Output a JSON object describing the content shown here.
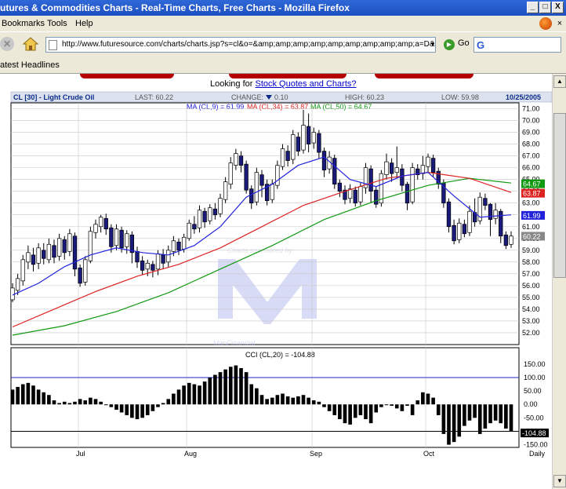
{
  "window": {
    "title": "utures & Commodities Charts - Real-Time Charts, Free Charts - Mozilla Firefox",
    "minimize": "_",
    "maximize": "□",
    "close": "X"
  },
  "menu": {
    "items": [
      "Bookmarks",
      "Tools",
      "Help"
    ],
    "close": "×"
  },
  "nav": {
    "url": "http://www.futuresource.com/charts/charts.jsp?s=cl&o=&amp;amp;amp;amp;amp;amp;amp;amp;amp;a=D&",
    "go_label": "Go",
    "search_placeholder": "",
    "stop": "✕"
  },
  "bookmarks": {
    "items": [
      "atest Headlines"
    ]
  },
  "page": {
    "looking_for_prefix": "Looking for ",
    "looking_for_link": "Stock Quotes and Charts?"
  },
  "header": {
    "symbol": "CL [30] - Light Crude Oil",
    "last": "LAST: 60.22",
    "change_label": "CHANGE:",
    "change_value": "0.10",
    "high": "HIGH: 60.23",
    "low": "LOW: 59.98",
    "date": "10/25/2005"
  },
  "legend": {
    "ma9": "MA (CL,9) = 61.99",
    "ma34": "MA (CL,34) = 63.87",
    "ma50": "MA (CL,50) = 64.67",
    "cci": "CCI (CL,20) = -104.88"
  },
  "watermark": {
    "sponsor": "Charts sponsored by:",
    "brand": "ManFinancial"
  },
  "colors": {
    "bull": "#ffffff",
    "bear": "#1a1a7a",
    "ma9": "#2222dd",
    "ma34": "#dd2222",
    "ma50": "#119911",
    "grid": "#c8c8c8",
    "header_bg": "#dde3ee",
    "accent": "#0a2a8a"
  },
  "chart_data": [
    {
      "type": "candlestick",
      "title": "CL [30] - Light Crude Oil",
      "x": [
        "Jul",
        "Aug",
        "Sep",
        "Oct",
        "Daily"
      ],
      "ylim": [
        51,
        71.5
      ],
      "yticks": [
        "71.00",
        "70.00",
        "69.00",
        "68.00",
        "67.00",
        "66.00",
        "65.00",
        "64.00",
        "63.00",
        "62.00",
        "61.00",
        "60.00",
        "59.00",
        "58.00",
        "57.00",
        "56.00",
        "55.00",
        "54.00",
        "53.00",
        "52.00"
      ],
      "tags": [
        {
          "value": 64.67,
          "label": "64.67",
          "color": "#119911"
        },
        {
          "value": 63.87,
          "label": "63.87",
          "color": "#dd2222"
        },
        {
          "value": 61.99,
          "label": "61.99",
          "color": "#2222dd"
        },
        {
          "value": 60.22,
          "label": "60.22",
          "color": "#888888"
        }
      ],
      "candles": [
        [
          54.8,
          55.8,
          54.6,
          56.2
        ],
        [
          55.6,
          56.6,
          55.2,
          57.0
        ],
        [
          56.4,
          58.2,
          56.0,
          58.6
        ],
        [
          58.0,
          58.8,
          57.4,
          59.4
        ],
        [
          58.6,
          57.8,
          57.2,
          59.2
        ],
        [
          57.9,
          59.2,
          57.4,
          59.6
        ],
        [
          59.0,
          58.3,
          57.8,
          59.6
        ],
        [
          58.2,
          59.5,
          57.9,
          60.0
        ],
        [
          59.4,
          58.4,
          57.9,
          59.9
        ],
        [
          58.5,
          60.0,
          58.1,
          60.4
        ],
        [
          59.9,
          58.8,
          58.2,
          60.2
        ],
        [
          58.9,
          60.4,
          58.5,
          60.8
        ],
        [
          60.2,
          57.4,
          56.8,
          60.5
        ],
        [
          57.5,
          56.2,
          55.9,
          57.8
        ],
        [
          56.3,
          58.2,
          56.0,
          58.5
        ],
        [
          58.1,
          60.6,
          57.9,
          61.0
        ],
        [
          60.5,
          61.2,
          60.0,
          61.6
        ],
        [
          61.0,
          61.8,
          60.5,
          62.0
        ],
        [
          61.7,
          60.8,
          60.3,
          62.1
        ],
        [
          60.9,
          59.3,
          58.8,
          61.2
        ],
        [
          59.4,
          60.8,
          59.0,
          61.2
        ],
        [
          60.7,
          59.2,
          58.8,
          61.0
        ],
        [
          59.3,
          60.4,
          58.7,
          60.7
        ],
        [
          60.3,
          58.8,
          57.9,
          60.6
        ],
        [
          58.9,
          58.0,
          57.5,
          59.3
        ],
        [
          58.1,
          57.3,
          56.9,
          58.5
        ],
        [
          57.4,
          57.9,
          56.8,
          58.2
        ],
        [
          57.8,
          57.3,
          56.7,
          58.1
        ],
        [
          57.4,
          58.7,
          56.9,
          59.0
        ],
        [
          58.6,
          57.9,
          57.4,
          59.1
        ],
        [
          58.0,
          59.0,
          57.6,
          59.4
        ],
        [
          58.9,
          59.8,
          58.5,
          60.2
        ],
        [
          59.7,
          59.0,
          58.6,
          60.0
        ],
        [
          59.1,
          60.1,
          58.8,
          60.4
        ],
        [
          60.0,
          61.3,
          59.8,
          61.6
        ],
        [
          61.2,
          60.8,
          60.4,
          61.9
        ],
        [
          60.9,
          62.4,
          60.5,
          62.8
        ],
        [
          62.3,
          61.4,
          60.9,
          62.6
        ],
        [
          61.5,
          62.6,
          61.2,
          62.9
        ],
        [
          62.5,
          62.0,
          61.6,
          63.0
        ],
        [
          62.1,
          63.4,
          61.8,
          63.8
        ],
        [
          63.3,
          64.8,
          63.0,
          65.2
        ],
        [
          64.6,
          66.4,
          64.2,
          66.9
        ],
        [
          66.2,
          67.2,
          65.8,
          67.6
        ],
        [
          67.0,
          66.2,
          65.6,
          67.4
        ],
        [
          66.3,
          64.1,
          63.8,
          66.6
        ],
        [
          64.2,
          63.0,
          62.5,
          64.5
        ],
        [
          63.1,
          65.6,
          62.8,
          66.0
        ],
        [
          65.4,
          64.5,
          63.5,
          65.8
        ],
        [
          64.6,
          63.2,
          62.8,
          65.0
        ],
        [
          63.3,
          64.6,
          63.0,
          65.0
        ],
        [
          64.5,
          66.2,
          64.2,
          66.6
        ],
        [
          66.1,
          67.6,
          65.8,
          68.0
        ],
        [
          67.4,
          66.6,
          66.1,
          67.9
        ],
        [
          66.7,
          68.8,
          66.3,
          69.2
        ],
        [
          68.6,
          67.4,
          67.0,
          69.0
        ],
        [
          67.5,
          69.6,
          67.2,
          70.9
        ],
        [
          69.5,
          68.0,
          67.3,
          70.6
        ],
        [
          68.1,
          69.0,
          67.6,
          69.4
        ],
        [
          68.9,
          67.3,
          66.8,
          69.2
        ],
        [
          67.4,
          65.8,
          65.2,
          67.7
        ],
        [
          65.9,
          66.9,
          65.5,
          67.4
        ],
        [
          66.8,
          64.6,
          64.2,
          67.1
        ],
        [
          64.7,
          64.0,
          63.5,
          65.0
        ],
        [
          64.1,
          63.3,
          62.9,
          64.5
        ],
        [
          63.4,
          64.2,
          63.0,
          64.6
        ],
        [
          64.1,
          63.0,
          62.7,
          64.4
        ],
        [
          63.1,
          64.4,
          62.8,
          64.7
        ],
        [
          64.3,
          66.0,
          63.8,
          66.4
        ],
        [
          65.9,
          64.0,
          63.0,
          66.2
        ],
        [
          64.1,
          62.9,
          62.6,
          64.4
        ],
        [
          63.0,
          65.5,
          62.7,
          65.8
        ],
        [
          65.4,
          66.5,
          65.0,
          67.2
        ],
        [
          66.4,
          65.5,
          64.8,
          66.8
        ],
        [
          65.6,
          66.0,
          65.1,
          67.8
        ],
        [
          65.9,
          64.5,
          64.0,
          66.3
        ],
        [
          64.6,
          63.0,
          62.4,
          64.8
        ],
        [
          63.1,
          66.0,
          62.9,
          66.4
        ],
        [
          65.9,
          65.4,
          65.0,
          66.3
        ],
        [
          65.5,
          66.2,
          65.0,
          67.0
        ],
        [
          66.1,
          66.9,
          65.6,
          67.2
        ],
        [
          66.8,
          65.6,
          65.2,
          67.1
        ],
        [
          65.7,
          64.6,
          64.2,
          66.0
        ],
        [
          64.7,
          63.0,
          62.6,
          65.0
        ],
        [
          63.1,
          61.0,
          60.5,
          63.4
        ],
        [
          61.1,
          59.8,
          59.5,
          61.6
        ],
        [
          59.9,
          61.3,
          59.6,
          61.7
        ],
        [
          61.2,
          60.4,
          60.1,
          61.6
        ],
        [
          60.5,
          62.3,
          60.2,
          62.8
        ],
        [
          62.2,
          61.4,
          61.0,
          63.4
        ],
        [
          61.5,
          63.5,
          61.2,
          63.9
        ],
        [
          63.4,
          62.8,
          62.4,
          63.8
        ],
        [
          62.9,
          61.6,
          60.2,
          63.0
        ],
        [
          61.7,
          62.4,
          61.2,
          63.0
        ],
        [
          62.3,
          60.2,
          59.6,
          62.5
        ],
        [
          60.3,
          59.4,
          59.1,
          60.6
        ],
        [
          59.5,
          60.2,
          59.2,
          60.6
        ]
      ],
      "ma9": [
        [
          0,
          55.2
        ],
        [
          5,
          56.2
        ],
        [
          10,
          57.6
        ],
        [
          15,
          58.6
        ],
        [
          20,
          59.2
        ],
        [
          25,
          58.8
        ],
        [
          30,
          58.6
        ],
        [
          35,
          59.4
        ],
        [
          40,
          61.0
        ],
        [
          45,
          63.5
        ],
        [
          50,
          64.6
        ],
        [
          55,
          66.2
        ],
        [
          60,
          66.9
        ],
        [
          65,
          65.0
        ],
        [
          70,
          64.4
        ],
        [
          75,
          65.3
        ],
        [
          80,
          65.6
        ],
        [
          85,
          63.6
        ],
        [
          90,
          61.8
        ],
        [
          96,
          62.0
        ]
      ],
      "ma34": [
        [
          0,
          52.5
        ],
        [
          8,
          54.0
        ],
        [
          16,
          55.5
        ],
        [
          24,
          56.8
        ],
        [
          32,
          57.8
        ],
        [
          40,
          59.2
        ],
        [
          48,
          61.0
        ],
        [
          56,
          62.8
        ],
        [
          64,
          64.0
        ],
        [
          72,
          65.1
        ],
        [
          80,
          65.6
        ],
        [
          88,
          65.1
        ],
        [
          96,
          63.9
        ]
      ],
      "ma50": [
        [
          0,
          51.8
        ],
        [
          10,
          52.6
        ],
        [
          20,
          53.8
        ],
        [
          30,
          55.4
        ],
        [
          40,
          57.4
        ],
        [
          50,
          59.4
        ],
        [
          60,
          61.6
        ],
        [
          70,
          63.2
        ],
        [
          80,
          64.5
        ],
        [
          88,
          65.1
        ],
        [
          96,
          64.7
        ]
      ]
    },
    {
      "type": "bar",
      "title": "CCI (CL,20) = -104.88",
      "ylim": [
        -160,
        170
      ],
      "yticks": [
        "150.00",
        "100.00",
        "50.00",
        "0.00",
        "-50.00",
        "-100.00",
        "-150.00"
      ],
      "reference_lines": [
        100,
        -100
      ],
      "tags": [
        {
          "value": -104.88,
          "label": "-104.88",
          "color": "#000000"
        }
      ],
      "values": [
        55,
        65,
        75,
        80,
        70,
        55,
        45,
        35,
        15,
        5,
        10,
        5,
        10,
        20,
        15,
        25,
        20,
        10,
        0,
        -10,
        -20,
        -30,
        -40,
        -50,
        -55,
        -50,
        -40,
        -25,
        -10,
        5,
        20,
        40,
        55,
        70,
        80,
        75,
        70,
        85,
        100,
        110,
        120,
        130,
        140,
        145,
        135,
        120,
        75,
        60,
        35,
        20,
        25,
        35,
        40,
        30,
        25,
        30,
        35,
        25,
        15,
        10,
        -10,
        -25,
        -40,
        -55,
        -70,
        -75,
        -50,
        -40,
        -55,
        -70,
        -30,
        -10,
        0,
        -5,
        -15,
        -25,
        -5,
        -40,
        15,
        45,
        40,
        25,
        -40,
        -110,
        -150,
        -140,
        -120,
        -80,
        -60,
        -50,
        -110,
        -90,
        -70,
        -60,
        -70,
        -90,
        -100
      ],
      "xlabels": [
        "Jul",
        "Aug",
        "Sep",
        "Oct",
        "Daily"
      ]
    }
  ]
}
